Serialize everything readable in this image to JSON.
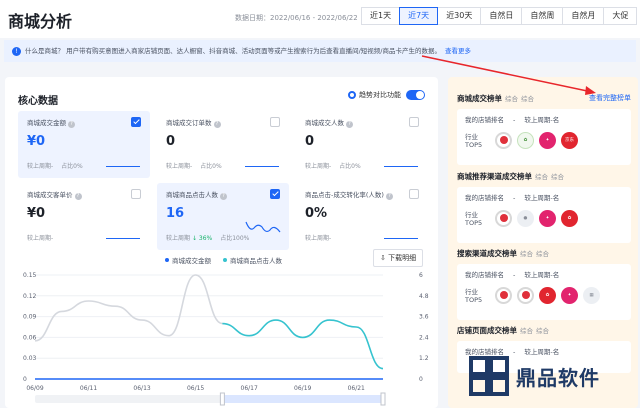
{
  "header": {
    "title": "商城分析",
    "date_range": "数据日期：2022/06/16 - 2022/06/22",
    "tabs": [
      "近1天",
      "近7天",
      "近30天",
      "自然日",
      "自然周",
      "自然月",
      "大促"
    ],
    "active_tab": "近7天"
  },
  "notice": {
    "icon": "info-icon",
    "text": "什么是商城？ 用户带有购买意图进入商家店铺页面、达人橱窗、抖音商城、活动页面等或产生搜索行为后查看直播间/短视频/商品卡产生的数据。",
    "link": "查看更多"
  },
  "core": {
    "title": "核心数据",
    "compare_label": "趋势对比功能",
    "cards": [
      {
        "label": "商城成交金额",
        "value": "¥0",
        "compare": "较上周期-",
        "share": "占比0%",
        "checked": true,
        "selected": true
      },
      {
        "label": "商城成交订单数",
        "value": "0",
        "compare": "较上周期-",
        "share": "占比0%",
        "checked": false,
        "selected": false
      },
      {
        "label": "商城成交人数",
        "value": "0",
        "compare": "较上周期-",
        "share": "占比0%",
        "checked": false,
        "selected": false
      },
      {
        "label": "商城成交客单价",
        "value": "¥0",
        "compare": "较上周期-",
        "share": "",
        "checked": false,
        "selected": false
      },
      {
        "label": "商城商品点击人数",
        "value": "16",
        "compare": "较上周期",
        "delta": "↓ 36%",
        "share": "占比100%",
        "checked": true,
        "selected": true
      },
      {
        "label": "商品点击-成交转化率(人数)",
        "value": "0%",
        "compare": "较上周期-",
        "share": "",
        "checked": false,
        "selected": false
      }
    ],
    "download_label": "下载明细"
  },
  "chart_data": {
    "type": "line",
    "x": [
      "06/09",
      "06/10",
      "06/11",
      "06/12",
      "06/13",
      "06/14",
      "06/15",
      "06/16",
      "06/17",
      "06/18",
      "06/19",
      "06/20",
      "06/21",
      "06/22"
    ],
    "x_tick_labels": [
      "06/09",
      "06/11",
      "06/13",
      "06/15",
      "06/17",
      "06/19",
      "06/21"
    ],
    "series": [
      {
        "name": "商城成交金额",
        "axis": "left",
        "color": "#1e66f5",
        "values": [
          0,
          0,
          0,
          0,
          0,
          0,
          0,
          0,
          0,
          0,
          0,
          0,
          0,
          0
        ]
      },
      {
        "name": "商城商品点击人数",
        "axis": "right",
        "color": "#36c3cf",
        "values": [
          2.2,
          3.9,
          4.5,
          4.2,
          3.4,
          2.5,
          6,
          3.2,
          2.5,
          3.4,
          2.4,
          3.4,
          3,
          0.6
        ]
      }
    ],
    "y_left": {
      "ticks": [
        "0",
        "0.03",
        "0.06",
        "0.09",
        "0.12",
        "0.15"
      ],
      "range": [
        0,
        0.15
      ]
    },
    "y_right": {
      "ticks": [
        "0",
        "1.2",
        "2.4",
        "3.6",
        "4.8",
        "6"
      ],
      "range": [
        0,
        6
      ]
    },
    "highlight_from_index": 7,
    "legend_position": "top"
  },
  "ranks": {
    "more_label": "查看完整榜单",
    "blocks": [
      {
        "title": "商城成交榜单",
        "sub": "综合",
        "sub2": "综合",
        "my_rank": "我的店铺排名",
        "dash": "-",
        "vs": "较上周期-名",
        "top5_label": "行业TOP5",
        "logos": [
          "l-red",
          "l-green",
          "l-pink",
          "l-crimson"
        ],
        "logo_text": [
          "",
          "",
          "",
          "京东"
        ]
      },
      {
        "title": "商城推荐渠道成交榜单",
        "sub": "综合",
        "sub2": "综合",
        "my_rank": "我的店铺排名",
        "dash": "-",
        "vs": "较上周期-名",
        "top5_label": "行业TOP5",
        "logos": [
          "l-red",
          "l-grey",
          "l-pink",
          "l-crimson"
        ],
        "logo_text": [
          "",
          "",
          "",
          ""
        ]
      },
      {
        "title": "搜索渠道成交榜单",
        "sub": "综合",
        "sub2": "综合",
        "my_rank": "我的店铺排名",
        "dash": "-",
        "vs": "较上周期-名",
        "top5_label": "行业TOP5",
        "logos": [
          "l-red",
          "l-red",
          "l-crimson",
          "l-pink",
          "l-grey"
        ],
        "logo_text": [
          "",
          "",
          "",
          "",
          ""
        ]
      },
      {
        "title": "店铺页面成交榜单",
        "sub": "综合",
        "sub2": "综合",
        "my_rank": "我的店铺排名",
        "dash": "-",
        "vs": "较上周期-名"
      }
    ]
  },
  "watermark": "鼎品软件"
}
